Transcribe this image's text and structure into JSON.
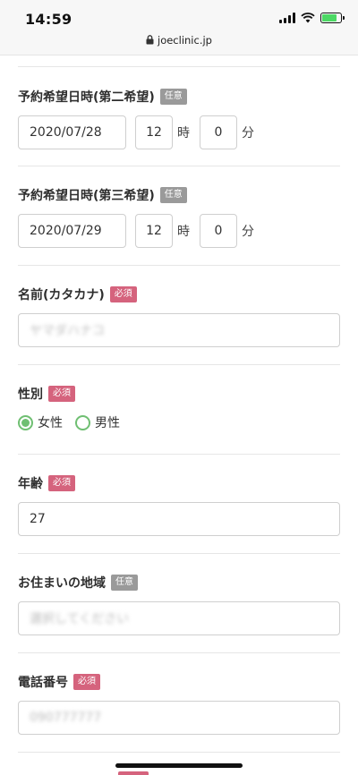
{
  "status_bar": {
    "time": "14:59",
    "url": "joeclinic.jp",
    "battery_level": 0.8,
    "icons": [
      "signal-icon",
      "wifi-icon",
      "battery-charging-icon",
      "lock-icon"
    ]
  },
  "colors": {
    "required_badge": "#d5637d",
    "optional_badge": "#9a9a9a",
    "radio_accent": "#6fbf72"
  },
  "form": {
    "second_choice": {
      "label": "予約希望日時(第二希望)",
      "badge": "任意",
      "date": "2020/07/28",
      "hour": "12",
      "hour_unit": "時",
      "minute": "0",
      "minute_unit": "分"
    },
    "third_choice": {
      "label": "予約希望日時(第三希望)",
      "badge": "任意",
      "date": "2020/07/29",
      "hour": "12",
      "hour_unit": "時",
      "minute": "0",
      "minute_unit": "分"
    },
    "name_kana": {
      "label": "名前(カタカナ)",
      "badge": "必須",
      "value": "ヤマダハナコ"
    },
    "gender": {
      "label": "性別",
      "badge": "必須",
      "options": [
        {
          "label": "女性",
          "checked": true
        },
        {
          "label": "男性",
          "checked": false
        }
      ]
    },
    "age": {
      "label": "年齢",
      "badge": "必須",
      "value": "27"
    },
    "region": {
      "label": "お住まいの地域",
      "badge": "任意",
      "placeholder": "選択してください"
    },
    "phone": {
      "label": "電話番号",
      "badge": "必須",
      "value": "090777777"
    }
  }
}
